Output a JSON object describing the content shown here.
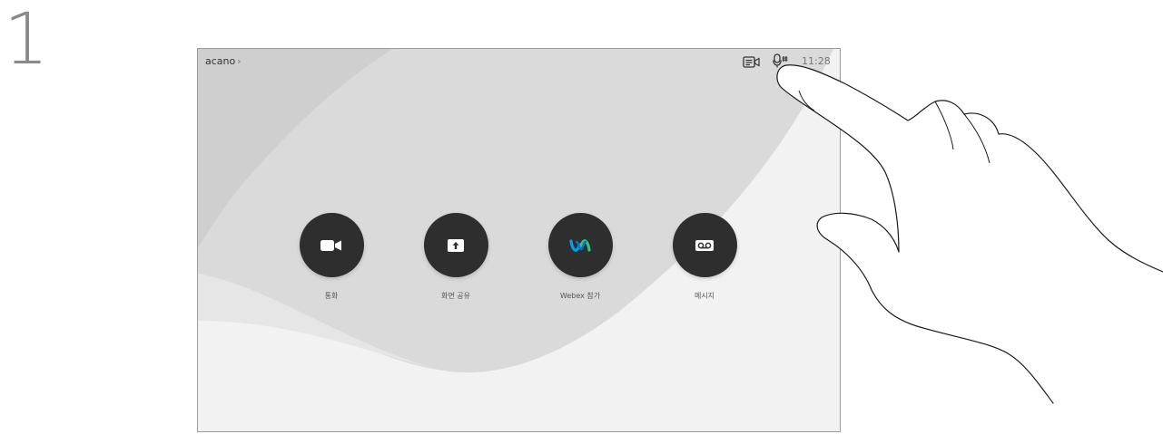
{
  "step": {
    "number": "1"
  },
  "header": {
    "device_name": "acano",
    "chevron": "›",
    "clock": "11:28",
    "icons": [
      "self-view-icon",
      "microphone-icon"
    ]
  },
  "actions": [
    {
      "label": "통화",
      "icon": "video-camera-icon"
    },
    {
      "label": "화면 공유",
      "icon": "share-screen-icon"
    },
    {
      "label": "Webex 참가",
      "icon": "webex-logo-icon"
    },
    {
      "label": "메시지",
      "icon": "voicemail-icon"
    }
  ],
  "colors": {
    "button_bg": "#2e2e2e",
    "screen_bg": "#f4f4f4",
    "wave_shape": "#d6d6d6",
    "webex_blue": "#00a0e6",
    "webex_green": "#2fc47a"
  }
}
